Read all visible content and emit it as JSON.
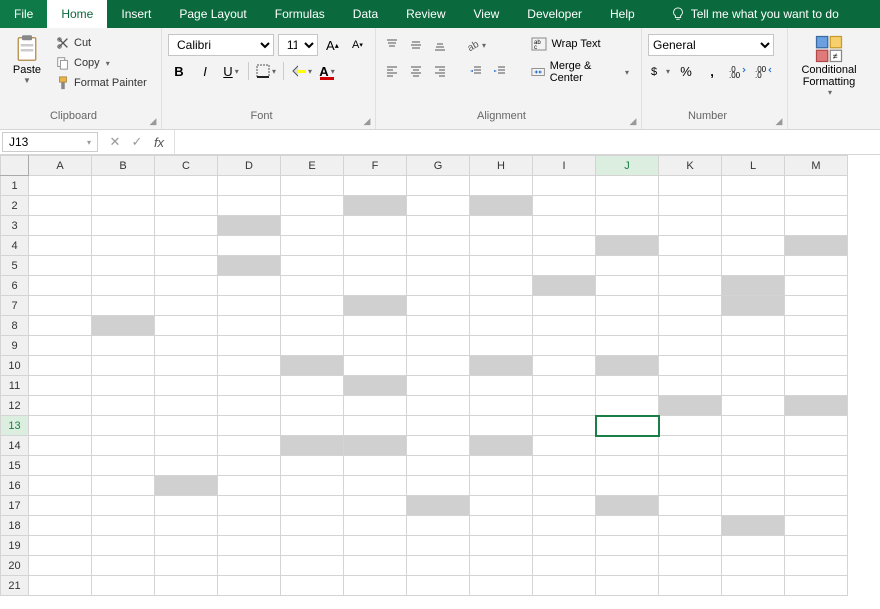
{
  "tabs": [
    "File",
    "Home",
    "Insert",
    "Page Layout",
    "Formulas",
    "Data",
    "Review",
    "View",
    "Developer",
    "Help"
  ],
  "active_tab": "Home",
  "tellme": "Tell me what you want to do",
  "ribbon": {
    "clipboard": {
      "paste": "Paste",
      "cut": "Cut",
      "copy": "Copy",
      "fmtpainter": "Format Painter",
      "label": "Clipboard"
    },
    "font": {
      "name": "Calibri",
      "size": "11",
      "label": "Font",
      "bold": "B",
      "italic": "I",
      "underline": "U"
    },
    "alignment": {
      "wrap": "Wrap Text",
      "merge": "Merge & Center",
      "label": "Alignment"
    },
    "number": {
      "format": "General",
      "label": "Number"
    },
    "cond": {
      "label": "Conditional Formatting"
    }
  },
  "namebox": "J13",
  "formula": "",
  "cols": [
    "A",
    "B",
    "C",
    "D",
    "E",
    "F",
    "G",
    "H",
    "I",
    "J",
    "K",
    "L",
    "M"
  ],
  "rows": 21,
  "active": {
    "row": 13,
    "col": "J"
  },
  "shaded": [
    {
      "r": 2,
      "c": "F"
    },
    {
      "r": 2,
      "c": "H"
    },
    {
      "r": 3,
      "c": "D"
    },
    {
      "r": 4,
      "c": "J"
    },
    {
      "r": 4,
      "c": "M"
    },
    {
      "r": 5,
      "c": "D"
    },
    {
      "r": 6,
      "c": "I"
    },
    {
      "r": 6,
      "c": "L"
    },
    {
      "r": 7,
      "c": "F"
    },
    {
      "r": 7,
      "c": "L"
    },
    {
      "r": 8,
      "c": "B"
    },
    {
      "r": 10,
      "c": "E"
    },
    {
      "r": 10,
      "c": "H"
    },
    {
      "r": 10,
      "c": "J"
    },
    {
      "r": 11,
      "c": "F"
    },
    {
      "r": 12,
      "c": "K"
    },
    {
      "r": 12,
      "c": "M"
    },
    {
      "r": 14,
      "c": "E"
    },
    {
      "r": 14,
      "c": "F"
    },
    {
      "r": 14,
      "c": "H"
    },
    {
      "r": 16,
      "c": "C"
    },
    {
      "r": 17,
      "c": "G"
    },
    {
      "r": 17,
      "c": "J"
    },
    {
      "r": 18,
      "c": "L"
    }
  ]
}
